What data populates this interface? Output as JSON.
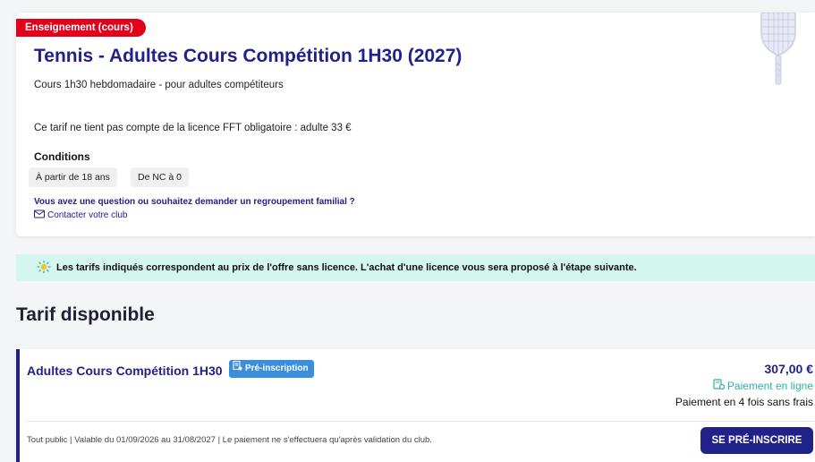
{
  "offer": {
    "category_badge": "Enseignement (cours)",
    "title": "Tennis - Adultes Cours Compétition 1H30 (2027)",
    "subtitle": "Cours 1h30 hebdomadaire - pour adultes compétiteurs",
    "licence_note": "Ce tarif ne tient pas compte de la licence FFT obligatoire : adulte 33 €",
    "conditions_heading": "Conditions",
    "conditions": [
      "À partir de 18 ans",
      "De NC à 0"
    ],
    "question_text": "Vous avez une question ou souhaitez demander un regroupement familial ?",
    "contact_link": "Contacter votre club",
    "sport_icon": "tennis-racket-icon"
  },
  "banner": {
    "icon": "lightbulb-icon",
    "text": "Les tarifs indiqués correspondent au prix de l'offre sans licence. L'achat d'une licence vous sera proposé à l'étape suivante."
  },
  "section": {
    "heading": "Tarif disponible"
  },
  "tariff": {
    "name": "Adultes Cours Compétition 1H30",
    "badge": "Pré-inscription",
    "price": "307,00 €",
    "online_payment": "Paiement en ligne",
    "installments": "Paiement en 4 fois sans frais",
    "footer": "Tout public | Valable du 01/09/2026 au 31/08/2027 | Le paiement ne s'effectuera qu'après validation du club.",
    "button_label": "SE PRÉ-INSCRIRE"
  },
  "colors": {
    "brand_navy": "#21218a",
    "badge_red": "#e2001a",
    "banner_mint": "#d5f6ee",
    "payment_green": "#2bb59a",
    "badge_blue": "#3b8fd9"
  }
}
